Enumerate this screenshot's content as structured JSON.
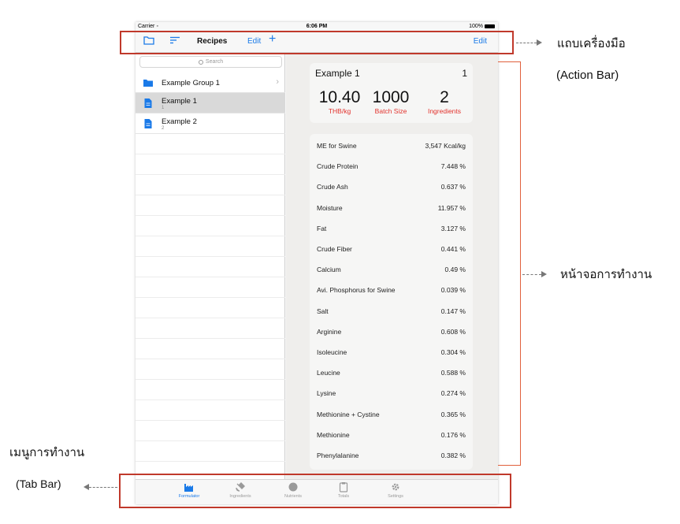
{
  "statusbar": {
    "carrier": "Carrier",
    "time": "6:06 PM",
    "battery": "100%"
  },
  "actionbar": {
    "title": "Recipes",
    "edit_left": "Edit",
    "add": "+",
    "edit_right": "Edit"
  },
  "search": {
    "placeholder": "Search"
  },
  "recipes": [
    {
      "name": "Example Group 1",
      "sub": "",
      "icon": "folder-icon"
    },
    {
      "name": "Example 1",
      "sub": "1",
      "icon": "document-icon"
    },
    {
      "name": "Example 2",
      "sub": "2",
      "icon": "document-icon"
    }
  ],
  "detail": {
    "name": "Example 1",
    "number": "1",
    "price": "10.40",
    "price_label": "THB/kg",
    "batch": "1000",
    "batch_label": "Batch Size",
    "ingredients": "2",
    "ingredients_label": "Ingredients"
  },
  "nutrients": [
    {
      "name": "ME for Swine",
      "value": "3,547 Kcal/kg"
    },
    {
      "name": "Crude Protein",
      "value": "7.448 %"
    },
    {
      "name": "Crude Ash",
      "value": "0.637 %"
    },
    {
      "name": "Moisture",
      "value": "11.957 %"
    },
    {
      "name": "Fat",
      "value": "3.127 %"
    },
    {
      "name": "Crude Fiber",
      "value": "0.441 %"
    },
    {
      "name": "Calcium",
      "value": "0.49 %"
    },
    {
      "name": "Avi. Phosphorus for Swine",
      "value": "0.039 %"
    },
    {
      "name": "Salt",
      "value": "0.147 %"
    },
    {
      "name": "Arginine",
      "value": "0.608 %"
    },
    {
      "name": "Isoleucine",
      "value": "0.304 %"
    },
    {
      "name": "Leucine",
      "value": "0.588 %"
    },
    {
      "name": "Lysine",
      "value": "0.274 %"
    },
    {
      "name": "Methionine + Cystine",
      "value": "0.365 %"
    },
    {
      "name": "Methionine",
      "value": "0.176 %"
    },
    {
      "name": "Phenylalanine",
      "value": "0.382 %"
    }
  ],
  "tabs": [
    {
      "label": "Formulator",
      "icon": "factory-icon",
      "active": true
    },
    {
      "label": "Ingredients",
      "icon": "satellite-icon",
      "active": false
    },
    {
      "label": "Nutrients",
      "icon": "circle-icon",
      "active": false
    },
    {
      "label": "Totals",
      "icon": "clipboard-icon",
      "active": false
    },
    {
      "label": "Settings",
      "icon": "gear-icon",
      "active": false
    }
  ],
  "annotations": {
    "action_bar_th": "แถบเครื่องมือ",
    "action_bar_en": "(Action Bar)",
    "workspace_th": "หน้าจอการทำงาน",
    "tab_bar_th": "เมนูการทำงาน",
    "tab_bar_en": "(Tab Bar)"
  },
  "colors": {
    "accent": "#1a7ae8",
    "stat_label": "#e2322d",
    "annotation_box": "#c0392b"
  }
}
